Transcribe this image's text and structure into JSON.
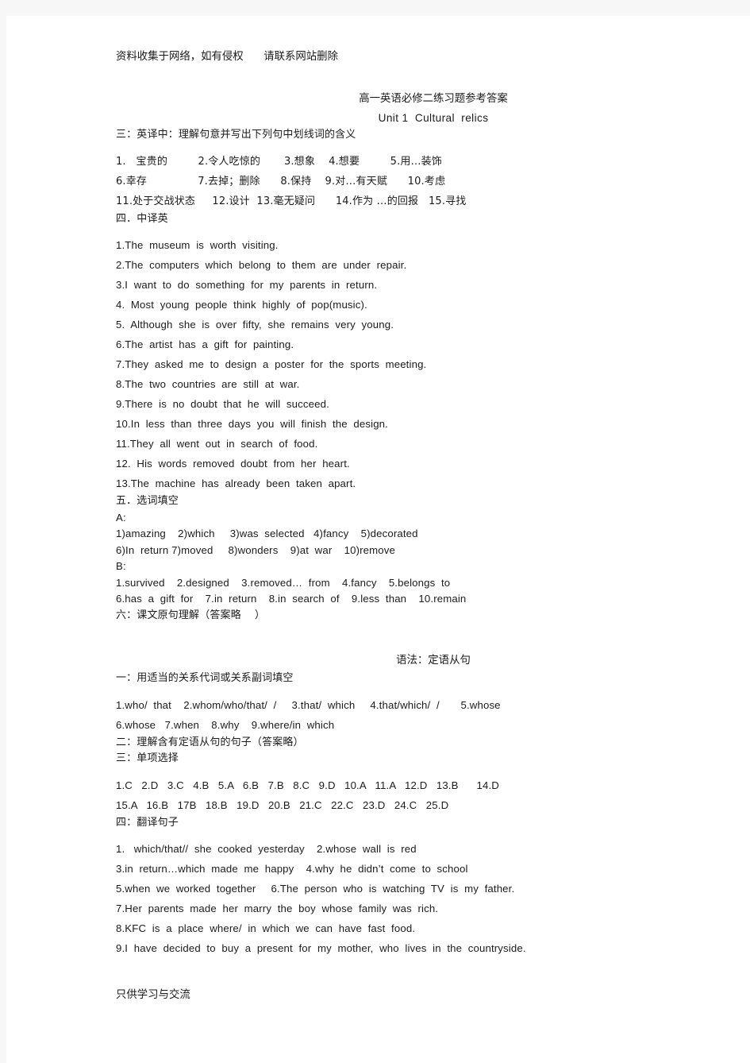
{
  "document": {
    "watermark_top": "资料收集于网络，如有侵权      请联系网站删除",
    "watermark_bottom": "只供学习与交流",
    "title": "高一英语必修二练习题参考答案",
    "unit_title": "Unit 1  Cultural  relics"
  },
  "section_three": {
    "heading": "三：英译中：理解句意并写出下列句中划线词的含义",
    "lines": [
      "1.   宝贵的         2.令人吃惊的       3.想象    4.想要         5.用…装饰",
      "6.幸存               7.去掉；删除      8.保持    9.对…有天赋      10.考虑",
      "11.处于交战状态     12.设计  13.毫无疑问      14.作为 …的回报   15.寻找"
    ]
  },
  "section_four": {
    "heading": "四．中译英",
    "lines": [
      "1.The  museum  is  worth  visiting.",
      "2.The  computers  which  belong  to  them  are  under  repair.",
      "3.I  want  to  do  something  for  my  parents  in  return.",
      "4.  Most  young  people  think  highly  of  pop(music).",
      "5.  Although  she  is  over  fifty,  she  remains  very  young.",
      "6.The  artist  has  a  gift  for  painting.",
      "7.They  asked  me  to  design  a  poster  for  the  sports  meeting.",
      "8.The  two  countries  are  still  at  war.",
      "9.There  is  no  doubt  that  he  will  succeed.",
      "10.In  less  than  three  days  you  will  finish  the  design.",
      "11.They  all  went  out  in  search  of  food.",
      "12.  His  words  removed  doubt  from  her  heart.",
      "13.The  machine  has  already  been  taken  apart."
    ]
  },
  "section_five": {
    "heading": "五．选词填空",
    "group_a_label": "A:",
    "group_a_lines": [
      "1)amazing    2)which     3)was  selected   4)fancy    5)decorated",
      "6)In  return 7)moved     8)wonders    9)at  war    10)remove"
    ],
    "group_b_label": "B:",
    "group_b_lines": [
      "1.survived    2.designed    3.removed…  from    4.fancy    5.belongs  to",
      "6.has  a  gift  for    7.in  return    8.in  search  of    9.less  than    10.remain"
    ]
  },
  "section_six": {
    "heading": "六：课文原句理解（答案略    ）"
  },
  "grammar": {
    "title": "语法：定语从句",
    "part_one_heading": "一：用适当的关系代词或关系副词填空",
    "part_one_lines": [
      "1.who/  that    2.whom/who/that/  /     3.that/  which     4.that/which/  /       5.whose",
      "6.whose   7.when    8.why    9.where/in  which"
    ],
    "part_two_heading": "二：理解含有定语从句的句子（答案略）",
    "part_three_heading": "三：单项选择",
    "part_three_lines": [
      "1.C   2.D   3.C   4.B   5.A   6.B   7.B   8.C   9.D   10.A   11.A   12.D   13.B      14.D",
      "15.A   16.B   17B   18.B   19.D   20.B   21.C   22.C   23.D   24.C   25.D"
    ],
    "part_four_heading": "四：翻译句子",
    "part_four_lines": [
      "1.   which/that//  she  cooked  yesterday    2.whose  wall  is  red",
      "3.in  return…which  made  me  happy    4.why  he  didn’t  come  to  school",
      "5.when  we  worked  together     6.The  person  who  is  watching  TV  is  my  father.",
      "7.Her  parents  made  her  marry  the  boy  whose  family  was  rich.",
      "8.KFC  is  a  place  where/  in  which  we  can  have  fast  food.",
      "9.I  have  decided  to  buy  a  present  for  my  mother,  who  lives  in  the  countryside."
    ]
  }
}
